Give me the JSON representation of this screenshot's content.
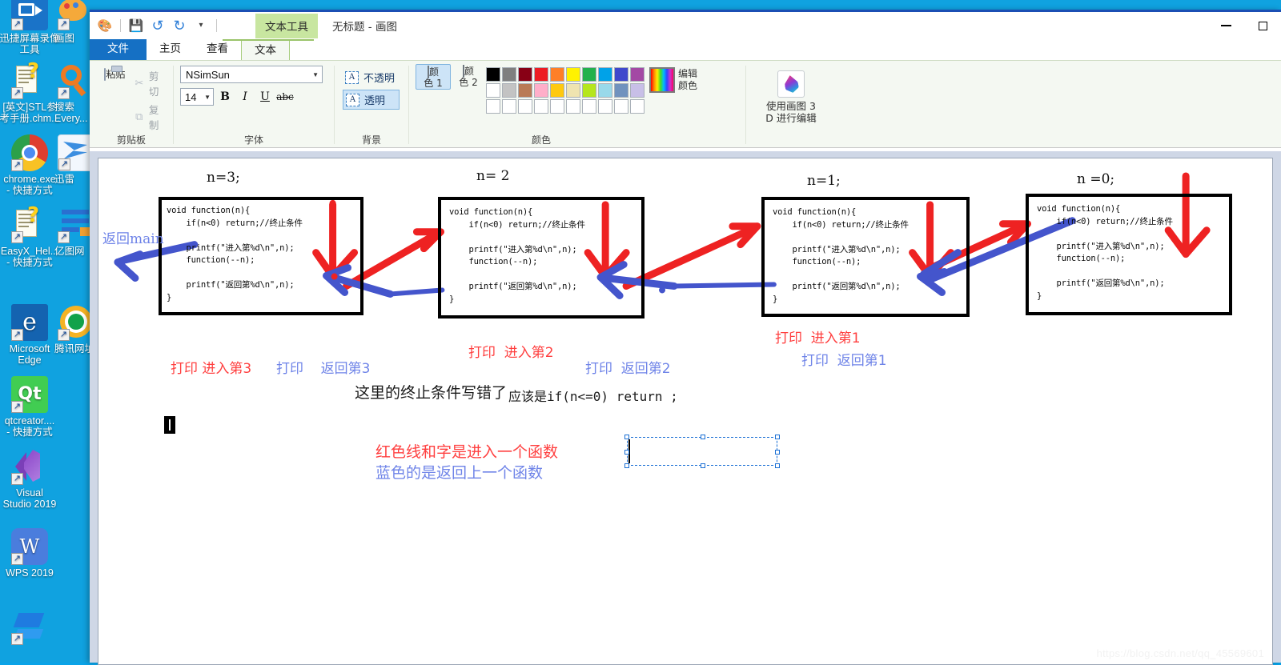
{
  "desktop": {
    "icons": [
      {
        "label": "迅捷屏幕录像\n工具",
        "icon": "video-recorder-icon",
        "color": "#1a73c8",
        "col": 0,
        "row": 0
      },
      {
        "label": "[英文]STL参\n考手册.chm...",
        "icon": "chm-help-icon",
        "color": "#e8e8e8",
        "col": 0,
        "row": 1
      },
      {
        "label": "chrome.exe\n- 快捷方式",
        "icon": "chrome-icon",
        "color": "#ffffff",
        "col": 0,
        "row": 2
      },
      {
        "label": "EasyX_Hel...\n- 快捷方式",
        "icon": "chm-help-icon",
        "color": "#e8e8e8",
        "col": 0,
        "row": 3
      },
      {
        "label": "Microsoft\nEdge",
        "icon": "edge-icon",
        "color": "#1463b0",
        "col": 0,
        "row": 4
      },
      {
        "label": "qtcreator....\n- 快捷方式",
        "icon": "qt-icon",
        "color": "#41cd52",
        "col": 0,
        "row": 5
      },
      {
        "label": "Visual\nStudio 2019",
        "icon": "visual-studio-icon",
        "color": "#8d4fd0",
        "col": 0,
        "row": 6
      },
      {
        "label": "WPS 2019",
        "icon": "wps-icon",
        "color": "#4a7ddd",
        "col": 0,
        "row": 7
      },
      {
        "label": "",
        "icon": "blue-box-icon",
        "color": "#1f7be0",
        "col": 0,
        "row": 8
      },
      {
        "label": "画图",
        "icon": "paint-icon",
        "color": "#f0a030",
        "col": 1,
        "row": 0
      },
      {
        "label": "搜索\nEvery...",
        "icon": "everything-search-icon",
        "color": "#f07a22",
        "col": 1,
        "row": 1
      },
      {
        "label": "迅雷",
        "icon": "thunder-icon",
        "color": "#3b8ee0",
        "col": 1,
        "row": 2
      },
      {
        "label": "亿图网",
        "icon": "edraw-icon",
        "color": "#2a6fd0",
        "col": 1,
        "row": 3
      },
      {
        "label": "腾讯网址",
        "icon": "tencent-icon",
        "color": "#f0b020",
        "col": 1,
        "row": 4
      }
    ]
  },
  "window": {
    "title": "无标题 - 画图",
    "context_tool_tab": "文本工具",
    "quick_access": [
      {
        "name": "paint-app-icon",
        "glyph": "🎨"
      },
      {
        "name": "save-icon",
        "glyph": "💾"
      },
      {
        "name": "undo-icon",
        "glyph": "↺"
      },
      {
        "name": "redo-icon",
        "glyph": "↻"
      },
      {
        "name": "customize-qat-icon",
        "glyph": "▾"
      }
    ],
    "controls": {
      "minimize": "minimize-button",
      "maximize": "maximize-button"
    }
  },
  "ribbon": {
    "tabs": [
      {
        "label": "文件",
        "kind": "file",
        "active": false
      },
      {
        "label": "主页",
        "kind": "normal",
        "active": false
      },
      {
        "label": "查看",
        "kind": "normal",
        "active": false
      },
      {
        "label": "文本",
        "kind": "context",
        "active": true
      }
    ],
    "groups": {
      "clipboard": {
        "title": "剪贴板",
        "paste": "粘贴",
        "cut": "剪切",
        "copy": "复制"
      },
      "font": {
        "title": "字体",
        "font_family": "NSimSun",
        "font_size": "14",
        "bold": "B",
        "italic": "I",
        "underline": "U",
        "strike": "abc"
      },
      "background": {
        "title": "背景",
        "opaque": "不透明",
        "transparent": "透明",
        "selected": "透明"
      },
      "colors": {
        "title": "颜色",
        "color1_label": "颜\n色 1",
        "color2_label": "颜\n色 2",
        "color1_value": "#4233c7",
        "color2_value": "#ffffff",
        "edit_color_label": "编辑\n颜色",
        "row1": [
          "#000000",
          "#7f7f7f",
          "#880015",
          "#ed1c24",
          "#ff7f27",
          "#fff200",
          "#22b14c",
          "#00a2e8",
          "#3f48cc",
          "#a349a4"
        ],
        "row2": [
          "#ffffff",
          "#c3c3c3",
          "#b97a57",
          "#ffaec9",
          "#ffc90e",
          "#efe4b0",
          "#b5e61d",
          "#99d9ea",
          "#7092be",
          "#c8bfe7"
        ],
        "row3": [
          "#ffffff",
          "#ffffff",
          "#ffffff",
          "#ffffff",
          "#ffffff",
          "#ffffff",
          "#ffffff",
          "#ffffff",
          "#ffffff",
          "#ffffff"
        ]
      },
      "paint3d": {
        "label": "使用画图 3\nD 进行编辑"
      }
    }
  },
  "canvas": {
    "code_lines": [
      "void function(n){",
      "    if(n<0) return;//终止条件",
      "",
      "    printf(\"进入第%d\\n\",n);",
      "    function(--n);",
      "",
      "    printf(\"返回第%d\\n\",n);",
      "}"
    ],
    "frames": [
      {
        "n_label": "n=3;",
        "name": "code-box-1"
      },
      {
        "n_label": "n= 2",
        "name": "code-box-2"
      },
      {
        "n_label": "n=1;",
        "name": "code-box-3"
      },
      {
        "n_label": "n =0;",
        "name": "code-box-4"
      }
    ],
    "annotations": [
      {
        "text": "返回main",
        "color": "blue",
        "name": "annotation-return-main"
      },
      {
        "text": "打印 进入第3",
        "color": "red",
        "name": "annotation-print-enter-3"
      },
      {
        "text": "打印    返回第3",
        "color": "blue",
        "name": "annotation-print-return-3"
      },
      {
        "text": "打印  进入第2",
        "color": "red",
        "name": "annotation-print-enter-2"
      },
      {
        "text": "打印  返回第2",
        "color": "blue",
        "name": "annotation-print-return-2"
      },
      {
        "text": "打印  进入第1",
        "color": "red",
        "name": "annotation-print-enter-1"
      },
      {
        "text": "打印  返回第1",
        "color": "blue",
        "name": "annotation-print-return-1"
      },
      {
        "text": "这里的终止条件写错了",
        "color": "black",
        "name": "annotation-note-wrong-condition"
      },
      {
        "text": "应该是if(n<=0) return ;",
        "color": "black",
        "name": "annotation-note-correction"
      },
      {
        "text": "红色线和字是进入一个函数",
        "color": "red",
        "name": "legend-red"
      },
      {
        "text": "蓝色的是返回上一个函数",
        "color": "blue",
        "name": "legend-blue"
      }
    ],
    "colors": {
      "red_arrow": "#ee2222",
      "blue_arrow": "#4455cc",
      "red_text": "#ff5a5a",
      "blue_text": "#7a8ce8"
    },
    "watermark": "https://blog.csdn.net/qq_45569601"
  }
}
